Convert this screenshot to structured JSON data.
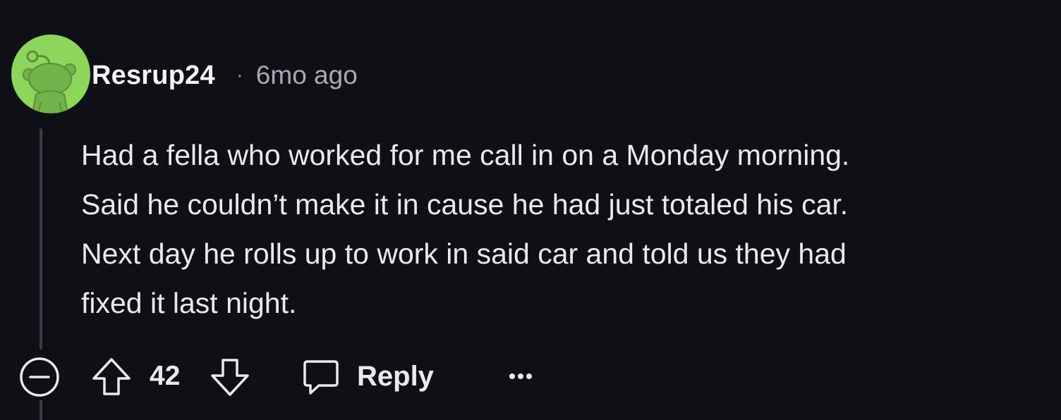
{
  "comment": {
    "username": "Resrup24",
    "separator": "·",
    "timestamp": "6mo ago",
    "body_lines": [
      "Had a fella who worked for me call in on a Monday morning.",
      "Said he couldn’t make it in cause he had just totaled his car.",
      "Next day he rolls up to work in said car and told us they had",
      "fixed it last night."
    ],
    "avatar": {
      "icon": "snoo-avatar-icon",
      "background_color": "#8bd65b"
    }
  },
  "actions": {
    "collapse_icon": "collapse-minus-icon",
    "upvote_icon": "upvote-arrow-icon",
    "vote_count": "42",
    "downvote_icon": "downvote-arrow-icon",
    "reply_icon": "speech-bubble-icon",
    "reply_label": "Reply",
    "more_icon": "more-options-icon",
    "more_label": "•••"
  },
  "colors": {
    "background": "#0e1016",
    "text": "#e8eaed",
    "muted_text": "#a7abb2",
    "thread_line": "#3a3d44"
  }
}
